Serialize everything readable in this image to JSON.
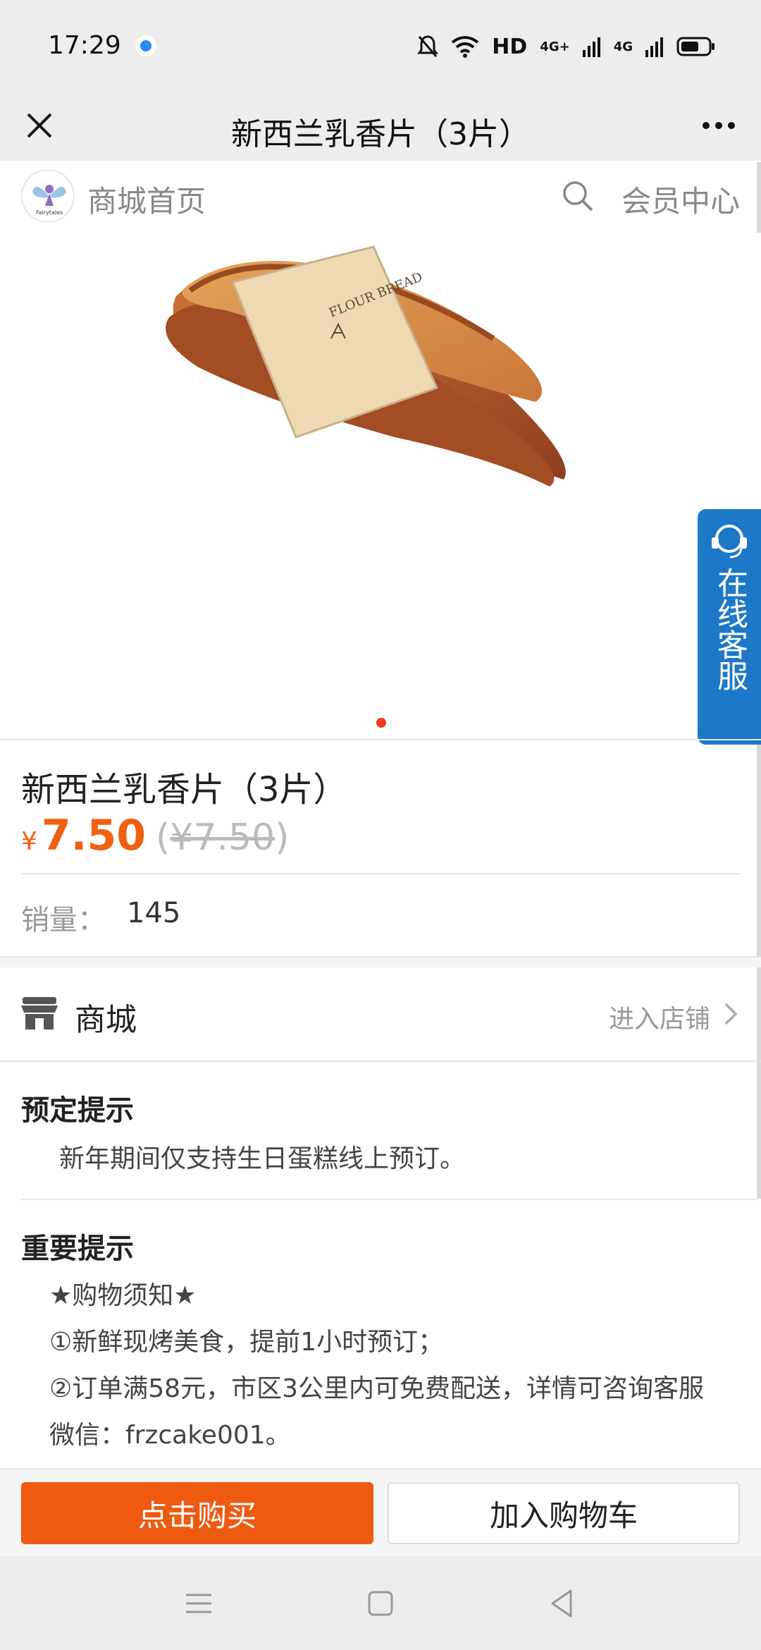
{
  "status_bar": {
    "time": "17:29",
    "network": "HD",
    "signal1": "4G+",
    "signal2": "4G",
    "icons": [
      "notification-dot-icon",
      "bell-mute-icon",
      "wifi-icon",
      "signal-icon",
      "battery-icon"
    ]
  },
  "header": {
    "title": "新西兰乳香片（3片）",
    "close_icon": "close-icon",
    "more_icon": "more-icon"
  },
  "shop_bar": {
    "logo_text": "Fairytales",
    "home_label": "商城首页",
    "member_label": "会员中心"
  },
  "floating_service": {
    "label": "在线客服"
  },
  "product": {
    "title": "新西兰乳香片（3片）",
    "currency": "¥",
    "price": "7.50",
    "original_price_open": "(",
    "original_price": "¥7.50",
    "original_price_close": ")",
    "sales_label": "销量：",
    "sales_value": "145",
    "image_band_text": "FLOUR BREAD",
    "carousel_count": 1,
    "carousel_active": 1
  },
  "store": {
    "name": "商城",
    "enter_label": "进入店铺"
  },
  "booking_notice": {
    "title": "预定提示",
    "text": "新年期间仅支持生日蛋糕线上预订。"
  },
  "important_notice": {
    "title": "重要提示",
    "lines": [
      "★购物须知★",
      "①新鲜现烤美食，提前1小时预订；",
      "②订单满58元，市区3公里内可免费配送，详情可咨询客服",
      "微信：frzcake001。"
    ]
  },
  "actions": {
    "buy_label": "点击购买",
    "cart_label": "加入购物车"
  },
  "colors": {
    "accent": "#ee5a10",
    "price": "#f06010",
    "service_blue": "#1e78c8",
    "indicator": "#ee3b1a"
  }
}
